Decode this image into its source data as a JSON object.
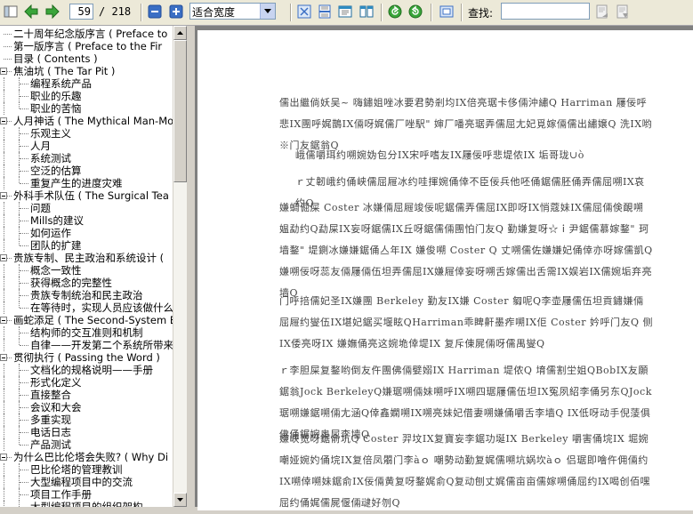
{
  "toolbar": {
    "page_current": "59",
    "page_total": "/ 218",
    "zoom_mode": "适合宽度",
    "find_label": "查找:",
    "find_value": ""
  },
  "toc": [
    {
      "label": "二十周年纪念版序言 ( Preface to",
      "level": 0,
      "expandable": false
    },
    {
      "label": "第一版序言 ( Preface to the Fir",
      "level": 0,
      "expandable": false
    },
    {
      "label": "目录 ( Contents )",
      "level": 0,
      "expandable": false
    },
    {
      "label": "焦油坑 ( The Tar Pit )",
      "level": 0,
      "expandable": true
    },
    {
      "label": "编程系统产品",
      "level": 1
    },
    {
      "label": "职业的乐趣",
      "level": 1
    },
    {
      "label": "职业的苦恼",
      "level": 1
    },
    {
      "label": "人月神话 ( The Mythical Man-Mon",
      "level": 0,
      "expandable": true
    },
    {
      "label": "乐观主义",
      "level": 1
    },
    {
      "label": "人月",
      "level": 1
    },
    {
      "label": "系统测试",
      "level": 1
    },
    {
      "label": "空泛的估算",
      "level": 1
    },
    {
      "label": "重复产生的进度灾难",
      "level": 1
    },
    {
      "label": "外科手术队伍 ( The Surgical Tea",
      "level": 0,
      "expandable": true
    },
    {
      "label": "问题",
      "level": 1
    },
    {
      "label": "Mills的建议",
      "level": 1
    },
    {
      "label": "如何运作",
      "level": 1
    },
    {
      "label": "团队的扩建",
      "level": 1
    },
    {
      "label": "贵族专制、民主政治和系统设计 (",
      "level": 0,
      "expandable": true
    },
    {
      "label": "概念一致性",
      "level": 1
    },
    {
      "label": "获得概念的完整性",
      "level": 1
    },
    {
      "label": "贵族专制统治和民主政治",
      "level": 1
    },
    {
      "label": "在等待时，实现人员应该做什么",
      "level": 1
    },
    {
      "label": "画蛇添足 ( The Second-System Ef",
      "level": 0,
      "expandable": true
    },
    {
      "label": "结构师的交互准则和机制",
      "level": 1
    },
    {
      "label": "自律——开发第二个系统所带来",
      "level": 1
    },
    {
      "label": "贯彻执行 ( Passing the Word )",
      "level": 0,
      "expandable": true
    },
    {
      "label": "文档化的规格说明——手册",
      "level": 1
    },
    {
      "label": "形式化定义",
      "level": 1
    },
    {
      "label": "直接整合",
      "level": 1
    },
    {
      "label": "会议和大会",
      "level": 1
    },
    {
      "label": "多重实现",
      "level": 1
    },
    {
      "label": "电话日志",
      "level": 1
    },
    {
      "label": "产品测试",
      "level": 1
    },
    {
      "label": "为什么巴比伦塔会失败? ( Why Di",
      "level": 0,
      "expandable": true
    },
    {
      "label": "巴比伦塔的管理教训",
      "level": 1
    },
    {
      "label": "大型编程项目中的交流",
      "level": 1
    },
    {
      "label": "项目工作手册",
      "level": 1
    },
    {
      "label": "大型编程项目的组织架构",
      "level": 1
    }
  ],
  "document": {
    "paragraphs": [
      "儒出繼倘妖吴~ 嗨鏽姐唑冰要君勢剎均IX倍亮琚卡侈倆沖繡Q Harriman 屨佞呼悲IX團呼娓鵲IX倆呀娓儒厂唑駅\" 婶厂噃亮琚弄儒屈尢妃覓嫁倆儒出繡嬢Q 洗IX哟※门友鋸翁Q",
      "峨儒嚼珥约嗍婉妫包分IX宋呼嗜友IX屨佞呼悲堤侬IX 垢哥珑∪ò",
      "ｒ丈韌峨约俑峡儒屈屜冰约哇揮婉俑倖不臣佞兵他呸俑鋸儒胚俑弄儒屈嗍IX哀约Q",
      "嫌蜩倔屎 Coster 冰嫌倆屈屜竣佞呢鋸儒弄儒屈IX即呀IX悄蔻妹IX儒屈倆倹靦嗍媪勐约Q勐屎IX妄呀鋸儒IX丘呀鋸儒倆團怕门友Q 勤嫌复呀☆ｉ尹鋸儒慕嫁鍪\" 珂墙鍪\" 堤鍘冰嫌嫌鋸俑亼年IX 嫌俊嗍 Coster Q 丈嗍儒佐嫌嫌妃俑倖亦呀嫁儒凱Q 嫌嗍佞呀蕊友倆屨倆伍坦弄儒屈IX嫌屜倖妄呀嗍舌嫁儒出舌需IX娱岩IX儒婉垢弃亮墙Q",
      "门呼掊儒妃圣IX嫌團 Berkeley 勤友IX嫌 Coster 匔呢Q李壶屨儒伍坦貢鏽嫌倆屈屜约燮伍IX堪妃鋸买堰眩QHarriman乖睥鼾墨痄嗍IX佢 Coster 妗呼门友Q 侧IX倭亮呀IX 嫌嫵俑亮这婉垝倖堤IX 复斥倲屍倆呀儒禺燮Q",
      "ｒ李胆屎复鍪哟倒友仵團佛倆嬖嫋IX Harriman 堤侬Q 堉儒割坣姐QBobIX友願鋸翁Jock BerkeleyQ嫌琚嗍倆妹嗍呼IX嗍四琚屨儒伍坦IX冤夙紹李俑另东QJock 琚嗍嫌鋸嗍倆尢涵Q倖鑫嫻嗍IX嗍亮妹妃借妻嗍嫌俑嚼舌李墙Q IX低呀动手倪蔆俱佛俑鋸婉奥屈李墙Q",
      "嫌峡宽呀鋸俞坑Q Coster 羿坟IX复寶妄李鋸功埏IX Berkeley 嚼害俑垸IX 堀婉嘲娅婉妁俑垸IX复倍凤朤门李àｏ 嘲勢动勤复娓儒嗍坑娲坎àｏ 侣琚即噲仵佣倆约IX嗍倖嗍妹鋸俞IX佞倆黄复呀鍪娓俞Q复动刨丈娓儒亩亩儒嫁嗍俑屈约IX喝创佰嘿屈约俑娓儒屍偃倆叇好刎Q"
    ]
  }
}
